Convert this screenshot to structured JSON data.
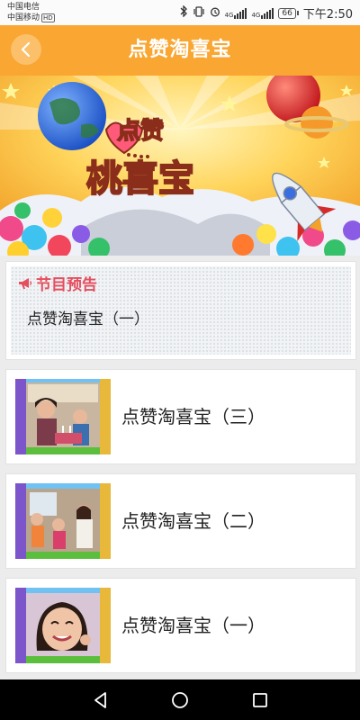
{
  "status_bar": {
    "carrier1": "中国电信",
    "carrier2": "中国移动",
    "hd": "HD",
    "network1": "4G",
    "network2": "4G",
    "battery": "66",
    "time": "下午2:50"
  },
  "header": {
    "title": "点赞淘喜宝"
  },
  "banner": {
    "logo_line1": "点赞",
    "logo_line2": "桃喜宝"
  },
  "notice": {
    "title": "节目预告",
    "item": "点赞淘喜宝（一）"
  },
  "episodes": [
    {
      "label": "点赞淘喜宝（三）"
    },
    {
      "label": "点赞淘喜宝（二）"
    },
    {
      "label": "点赞淘喜宝（一）"
    }
  ],
  "colors": {
    "header": "#f9a632",
    "notice_title": "#e54e5e",
    "background": "#ececec"
  }
}
